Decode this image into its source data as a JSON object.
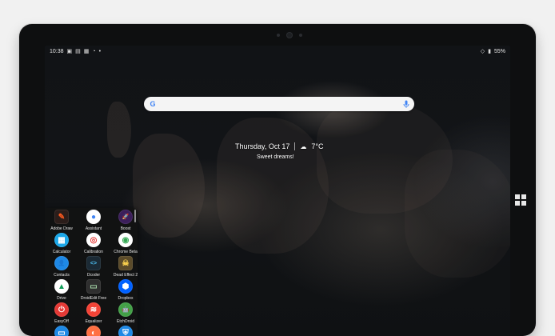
{
  "status": {
    "time": "10:38",
    "battery": "55%"
  },
  "search": {
    "google": "G"
  },
  "glance": {
    "date": "Thursday, Oct 17",
    "temp": "7°C",
    "greeting": "Sweet dreams!"
  },
  "drawer": {
    "apps": [
      {
        "label": "Adobe Draw",
        "icon": "adobe-draw-icon",
        "glyph": "✎",
        "color": "#2b1d1a",
        "fg": "#ff5a1f",
        "shape": "square"
      },
      {
        "label": "Assistant",
        "icon": "assistant-icon",
        "glyph": "●",
        "color": "#ffffff",
        "fg": "#4285f4"
      },
      {
        "label": "Boost",
        "icon": "boost-icon",
        "glyph": "🚀",
        "color": "#3b1e5a",
        "fg": "#ffffff"
      },
      {
        "label": "Calculator",
        "icon": "calculator-icon",
        "glyph": "▦",
        "color": "#1aa7e8",
        "fg": "#ffffff"
      },
      {
        "label": "Calibration",
        "icon": "calibration-icon",
        "glyph": "◎",
        "color": "#ffffff",
        "fg": "#e53935"
      },
      {
        "label": "Chrome Beta",
        "icon": "chrome-beta-icon",
        "glyph": "◉",
        "color": "#ffffff",
        "fg": "#34a853"
      },
      {
        "label": "Contacts",
        "icon": "contacts-icon",
        "glyph": "👤",
        "color": "#1e88e5",
        "fg": "#ffffff"
      },
      {
        "label": "Dcoder",
        "icon": "dcoder-icon",
        "glyph": "<>",
        "color": "#1b2a35",
        "fg": "#4fc3f7",
        "shape": "square"
      },
      {
        "label": "Dead Effect 2",
        "icon": "dead-effect-2-icon",
        "glyph": "☠",
        "color": "#5b4b2a",
        "fg": "#ffd54f",
        "shape": "square"
      },
      {
        "label": "Drive",
        "icon": "drive-icon",
        "glyph": "▲",
        "color": "#ffffff",
        "fg": "#0f9d58"
      },
      {
        "label": "DroidEdit Free",
        "icon": "droidedit-icon",
        "glyph": "▭",
        "color": "#2f2f2f",
        "fg": "#a5d6a7",
        "shape": "square"
      },
      {
        "label": "Dropbox",
        "icon": "dropbox-icon",
        "glyph": "⬢",
        "color": "#0061ff",
        "fg": "#ffffff"
      },
      {
        "label": "EasyOff",
        "icon": "easyoff-icon",
        "glyph": "⏻",
        "color": "#e53935",
        "fg": "#ffffff"
      },
      {
        "label": "Equalizer",
        "icon": "equalizer-icon",
        "glyph": "≋",
        "color": "#f44336",
        "fg": "#ffffff"
      },
      {
        "label": "EtchDroid",
        "icon": "etchdroid-icon",
        "glyph": "🤖",
        "color": "#43a047",
        "fg": "#ffffff"
      },
      {
        "label": "",
        "icon": "files-icon",
        "glyph": "▭",
        "color": "#1e88e5",
        "fg": "#ffffff"
      },
      {
        "label": "",
        "icon": "firefox-icon",
        "glyph": "◐",
        "color": "#ff7043",
        "fg": "#ffffff"
      },
      {
        "label": "",
        "icon": "shield-icon",
        "glyph": "⛨",
        "color": "#1e88e5",
        "fg": "#ffffff"
      }
    ]
  }
}
